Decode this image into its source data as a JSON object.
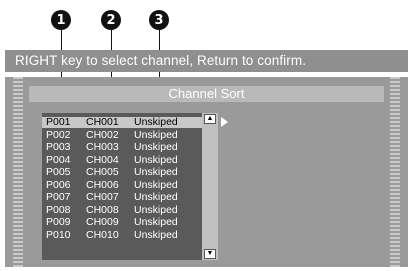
{
  "callouts": [
    "1",
    "2",
    "3"
  ],
  "instruction": "RIGHT key to select channel, Return to confirm.",
  "panel_title": "Channel Sort",
  "rows": [
    {
      "program": "P001",
      "channel": "CH001",
      "status": "Unskiped"
    },
    {
      "program": "P002",
      "channel": "CH002",
      "status": "Unskiped"
    },
    {
      "program": "P003",
      "channel": "CH003",
      "status": "Unskiped"
    },
    {
      "program": "P004",
      "channel": "CH004",
      "status": "Unskiped"
    },
    {
      "program": "P005",
      "channel": "CH005",
      "status": "Unskiped"
    },
    {
      "program": "P006",
      "channel": "CH006",
      "status": "Unskiped"
    },
    {
      "program": "P007",
      "channel": "CH007",
      "status": "Unskiped"
    },
    {
      "program": "P008",
      "channel": "CH008",
      "status": "Unskiped"
    },
    {
      "program": "P009",
      "channel": "CH009",
      "status": "Unskiped"
    },
    {
      "program": "P010",
      "channel": "CH010",
      "status": "Unskiped"
    }
  ],
  "selected_row": 0,
  "icons": {
    "scroll_up": "scroll-up-arrow-icon",
    "scroll_down": "scroll-down-arrow-icon",
    "select_right": "right-triangle-icon"
  }
}
